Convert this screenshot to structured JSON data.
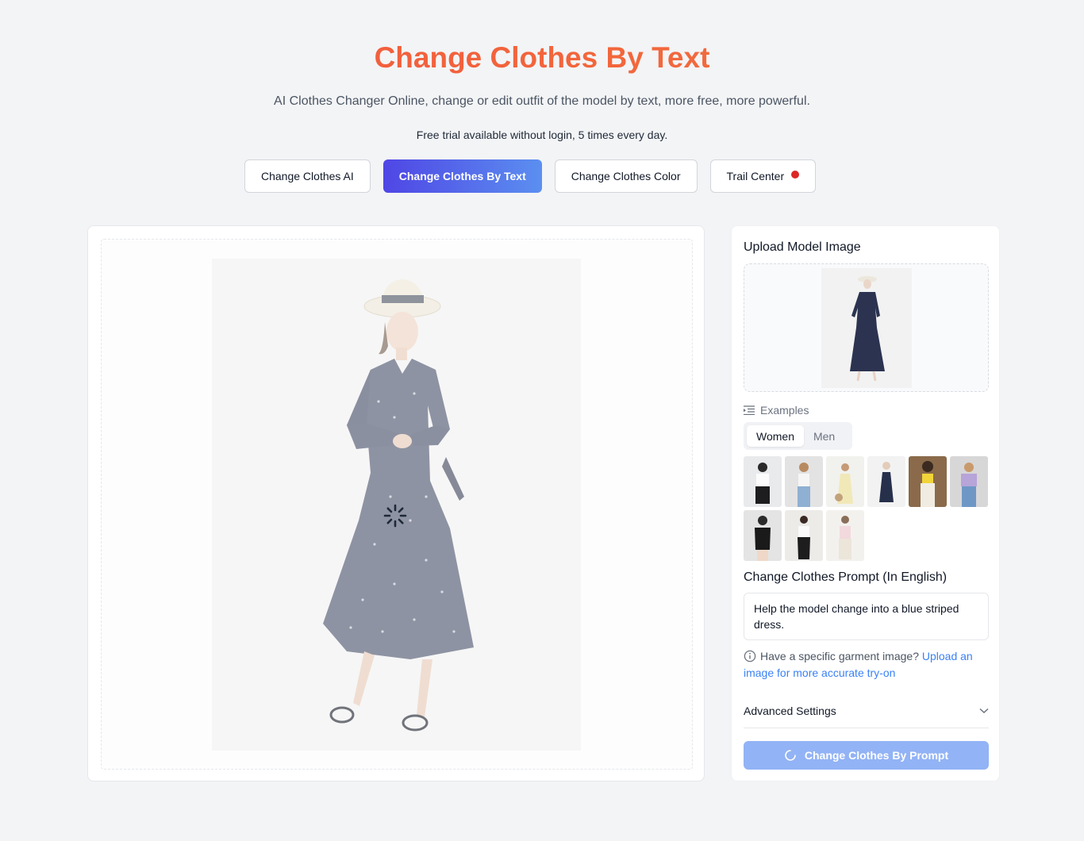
{
  "header": {
    "title": "Change Clothes By Text",
    "subtitle": "AI Clothes Changer Online, change or edit outfit of the model by text, more free, more powerful.",
    "notice": "Free trial available without login, 5 times every day."
  },
  "tabs": [
    {
      "label": "Change Clothes AI",
      "active": false
    },
    {
      "label": "Change Clothes By Text",
      "active": true
    },
    {
      "label": "Change Clothes Color",
      "active": false
    },
    {
      "label": "Trail Center",
      "active": false,
      "badge": "red-dot"
    }
  ],
  "colors": {
    "title_gradient_start": "#f2553f",
    "title_gradient_end": "#f2743a",
    "active_tab_start": "#4f46e5",
    "active_tab_end": "#5b8ff0",
    "link": "#3b82f6",
    "submit_bg": "#92b3f5"
  },
  "sidebar": {
    "upload_title": "Upload Model Image",
    "examples_label": "Examples",
    "example_tabs": [
      {
        "label": "Women",
        "active": true
      },
      {
        "label": "Men",
        "active": false
      }
    ],
    "example_count": 9,
    "prompt_title": "Change Clothes Prompt (In English)",
    "prompt_value": "Help the model change into a blue striped dress.",
    "hint_text": "Have a specific garment image?",
    "hint_link": "Upload an image for more accurate try-on",
    "advanced_label": "Advanced Settings",
    "submit_label": "Change Clothes By Prompt"
  }
}
